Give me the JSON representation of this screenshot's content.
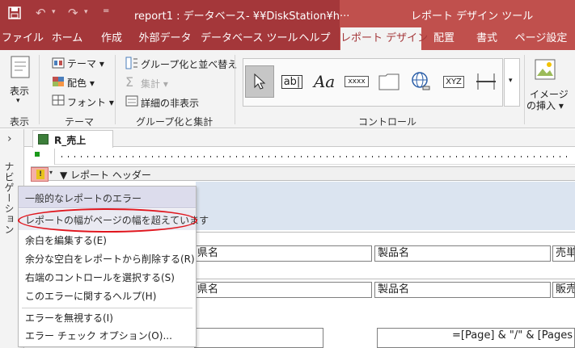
{
  "title_bar": {
    "doc_title": "report1 : データベース- ¥¥DiskStation¥h···",
    "context_title": "レポート デザイン ツール",
    "qat_more": "="
  },
  "tabs": [
    {
      "label": "ファイル"
    },
    {
      "label": "ホーム"
    },
    {
      "label": "作成"
    },
    {
      "label": "外部データ"
    },
    {
      "label": "データベース ツール"
    },
    {
      "label": "ヘルプ"
    },
    {
      "label": "レポート デザイン"
    },
    {
      "label": "配置"
    },
    {
      "label": "書式"
    },
    {
      "label": "ページ設定"
    }
  ],
  "ribbon": {
    "view": {
      "label": "表示",
      "group": "表示"
    },
    "theme": {
      "theme": "テーマ",
      "colors": "配色",
      "fonts": "フォント",
      "group": "テーマ"
    },
    "grouping": {
      "group_sort": "グループ化と並べ替え",
      "totals": "集計",
      "hide_details": "詳細の非表示",
      "group": "グループ化と集計"
    },
    "controls": {
      "group": "コントロール",
      "label_text": "ab|",
      "aa": "Aa",
      "xxxx": "xxxx",
      "xyz": "XYZ"
    },
    "image": {
      "label1": "イメージ",
      "label2": "の挿入"
    }
  },
  "nav": {
    "label": "ナビゲーション"
  },
  "doc_tab": {
    "label": "R_売上"
  },
  "section": {
    "report_header": "レポート ヘッダー"
  },
  "error_menu": {
    "header": "一般的なレポートのエラー",
    "highlighted": "レポートの幅がページの幅を超えています",
    "items": [
      "余白を編集する(E)",
      "余分な空白をレポートから削除する(R)",
      "右端のコントロールを選択する(S)",
      "このエラーに関するヘルプ(H)"
    ],
    "items2": [
      "エラーを無視する(I)",
      "エラー チェック オプション(O)..."
    ]
  },
  "fields": {
    "row1": [
      "県名",
      "製品名",
      "売単"
    ],
    "row2": [
      "県名",
      "製品名",
      "販売"
    ],
    "page_expr": "=[Page] & \"/\" & [Pages"
  }
}
